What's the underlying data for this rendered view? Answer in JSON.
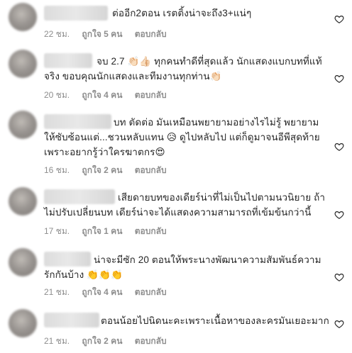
{
  "comments": [
    {
      "text": "ต่ออีก2ตอน เรตติ้งน่าจะถึง3+แน่ๆ",
      "time": "22 ชม.",
      "likes": "ถูกใจ 5 คน",
      "reply": "ตอบกลับ",
      "emojis": []
    },
    {
      "text": "จบ 2.7 👏🏻👍🏻 ทุกคนทำดีที่สุดแล้ว นักแสดงแบกบทที่แท้จริง ขอบคุณนักแสดงและทีมงานทุกท่าน👏🏻",
      "time": "20 ชม.",
      "likes": "ถูกใจ 4 คน",
      "reply": "ตอบกลับ",
      "emojis": [
        "clap-icon",
        "thumbs-up-icon",
        "clap-icon"
      ]
    },
    {
      "text": "บท ตัดต่อ มันเหมือนพยายามอย่างไรไม่รู้ พยายามให้ซับซ้อนแต่...ชวนหลับแทน 😥 ดูไปหลับไป แต่ก็ดูมาจนอีพีสุดท้าย เพราะอยากรู้ว่าใครฆาตกร😍",
      "time": "16 ชม.",
      "likes": "ถูกใจ 2 คน",
      "reply": "ตอบกลับ",
      "emojis": [
        "sad-face-icon",
        "heart-eyes-icon"
      ]
    },
    {
      "text": "เสียดายบทของเดียร์น่าที่ไม่เป็นไปตามนวนิยาย ถ้าไม่ปรับเปลี่ยนบท เดียร์น่าจะได้แสดงความสามารถที่เข้มข้นกว่านี้",
      "time": "17 ชม.",
      "likes": "ถูกใจ 1 คน",
      "reply": "ตอบกลับ",
      "emojis": []
    },
    {
      "text": "น่าจะมีซัก 20 ตอนให้พระนางพัฒนาความสัมพันธ์ความรักกันบ้าง 👏👏👏",
      "time": "21 ชม.",
      "likes": "ถูกใจ 4 คน",
      "reply": "ตอบกลับ",
      "emojis": [
        "clap-icon",
        "clap-icon",
        "clap-icon"
      ]
    },
    {
      "text": "ตอนน้อยไปนิดนะคะเพราะเนื้อหาของละครมันเยอะมาก",
      "time": "21 ชม.",
      "likes": "ถูกใจ 2 คน",
      "reply": "ตอบกลับ",
      "emojis": []
    }
  ],
  "icons": {
    "like": "heart-outline-icon"
  },
  "colors": {
    "text": "#262626",
    "meta": "#8e8e8e",
    "background": "#ffffff"
  }
}
